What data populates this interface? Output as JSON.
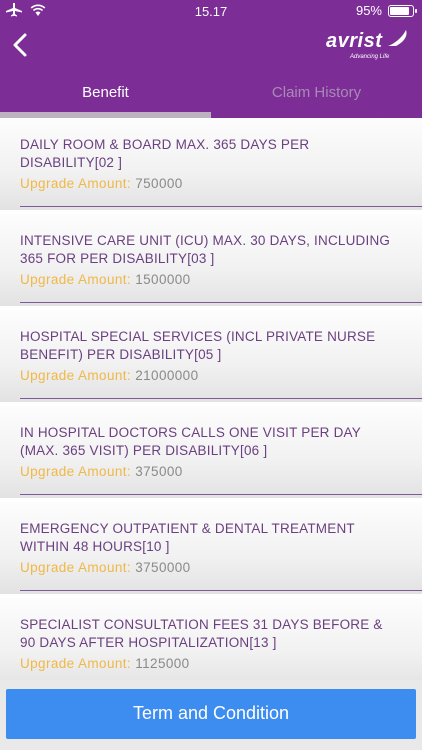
{
  "status_bar": {
    "time": "15.17",
    "battery": "95%"
  },
  "header": {
    "logo_text": "avrist",
    "logo_tagline": "Advancing Life"
  },
  "tabs": [
    {
      "label": "Benefit"
    },
    {
      "label": "Claim History"
    }
  ],
  "benefits": [
    {
      "title": "DAILY ROOM & BOARD MAX. 365 DAYS PER DISABILITY[02 ]",
      "amount_label": "Upgrade Amount:",
      "amount": "750000"
    },
    {
      "title": "INTENSIVE CARE UNIT (ICU) MAX. 30 DAYS, INCLUDING 365 FOR PER DISABILITY[03 ]",
      "amount_label": "Upgrade Amount:",
      "amount": "1500000"
    },
    {
      "title": "HOSPITAL SPECIAL SERVICES (INCL PRIVATE NURSE BENEFIT) PER DISABILITY[05 ]",
      "amount_label": "Upgrade Amount:",
      "amount": "21000000"
    },
    {
      "title": "IN HOSPITAL DOCTORS CALLS ONE VISIT PER DAY (MAX. 365 VISIT) PER DISABILITY[06 ]",
      "amount_label": "Upgrade Amount:",
      "amount": "375000"
    },
    {
      "title": "EMERGENCY OUTPATIENT & DENTAL TREATMENT WITHIN 48 HOURS[10 ]",
      "amount_label": "Upgrade Amount:",
      "amount": "3750000"
    },
    {
      "title": "SPECIALIST CONSULTATION FEES 31 DAYS BEFORE & 90 DAYS AFTER HOSPITALIZATION[13 ]",
      "amount_label": "Upgrade Amount:",
      "amount": "1125000"
    }
  ],
  "footer": {
    "button_label": "Term and Condition"
  },
  "colors": {
    "brand_purple": "#7c2e96",
    "accent_yellow": "#f0b846",
    "button_blue": "#3d8cf0"
  }
}
